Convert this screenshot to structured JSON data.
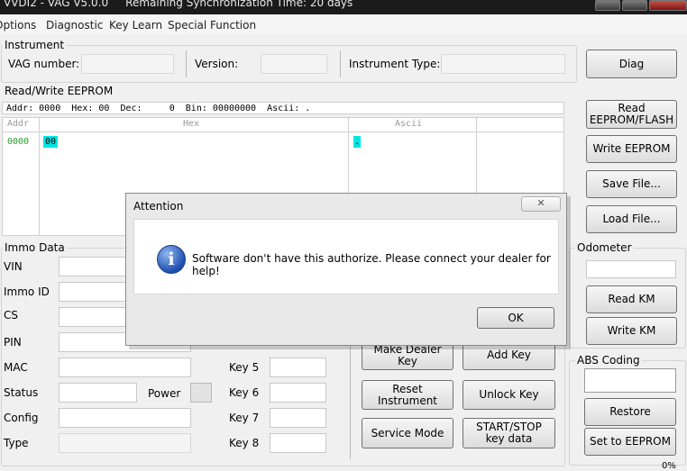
{
  "title": "VVDI2 - VAG V5.0.0",
  "sync_text": "Remaining Synchronization Time: 20 days",
  "menu": [
    "Options",
    "Diagnostic",
    "Key Learn",
    "Special Function"
  ],
  "instrument": {
    "group": "Instrument",
    "vag_number_label": "VAG number:",
    "version_label": "Version:",
    "type_label": "Instrument Type:",
    "diag_button": "Diag"
  },
  "eeprom": {
    "group": "Read/Write EEPROM",
    "status": {
      "addr_label": "Addr:",
      "addr": "0000",
      "hex_label": "Hex:",
      "hex": "00",
      "dec_label": "Dec:",
      "dec": "0",
      "bin_label": "Bin:",
      "bin": "00000000",
      "ascii_label": "Ascii:",
      "ascii": "."
    },
    "columns": [
      "Addr",
      "Hex",
      "Ascii"
    ],
    "rows": [
      {
        "addr": "0000",
        "hex": "00",
        "ascii": "."
      }
    ],
    "read_button": "Read EEPROM/FLASH",
    "write_button": "Write EEPROM",
    "save_button": "Save File...",
    "load_button": "Load File..."
  },
  "immo": {
    "group": "Immo Data",
    "fields": [
      "VIN",
      "Immo ID",
      "CS",
      "PIN",
      "MAC",
      "Status",
      "Config",
      "Type"
    ],
    "power_label": "Power",
    "keys": [
      "Key 5",
      "Key 6",
      "Key 7",
      "Key 8"
    ],
    "buttons": {
      "make_dealer_key": "Make Dealer Key",
      "add_key": "Add Key",
      "reset_instrument": "Reset Instrument",
      "unlock_key": "Unlock Key",
      "service_mode": "Service Mode",
      "start_stop_key": "START/STOP key data"
    }
  },
  "odometer": {
    "group": "Odometer",
    "read_button": "Read KM",
    "write_button": "Write KM"
  },
  "abs": {
    "group": "ABS Coding",
    "restore_button": "Restore",
    "set_button": "Set to EEPROM"
  },
  "dialog": {
    "title": "Attention",
    "icon": "info-icon",
    "message": "Software don't have this authorize. Please connect your dealer for help!",
    "ok_button": "OK",
    "close_glyph": "✕"
  },
  "bottom_right": "0%",
  "colors": {
    "hex_highlight": "#00e5e5",
    "addr_text": "#2aa02a",
    "icon_blue": "#1d4fb0"
  }
}
